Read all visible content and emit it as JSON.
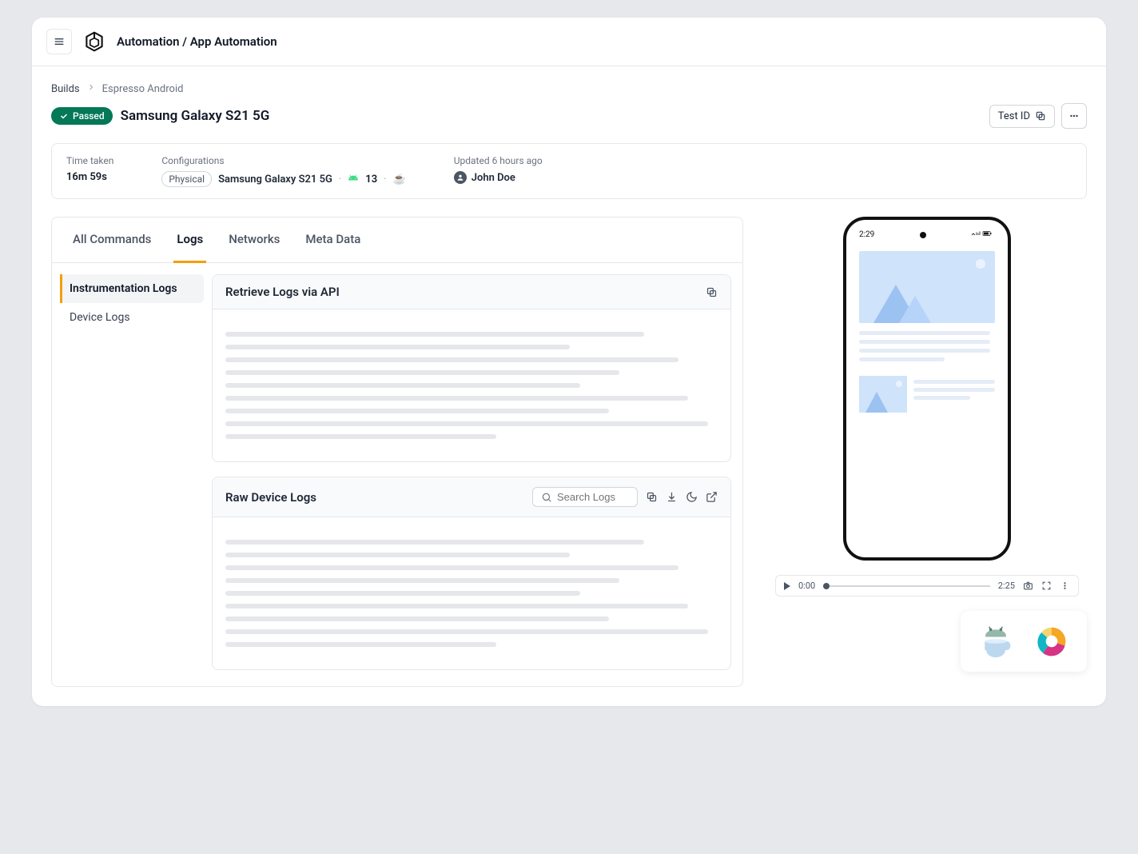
{
  "header": {
    "title": "Automation / App Automation"
  },
  "breadcrumb": {
    "root": "Builds",
    "current": "Espresso Android"
  },
  "status": {
    "label": "Passed"
  },
  "page_title": "Samsung Galaxy S21 5G",
  "actions": {
    "test_id": "Test ID"
  },
  "info": {
    "time_label": "Time taken",
    "time_value": "16m 59s",
    "config_label": "Configurations",
    "config_chip": "Physical",
    "config_device": "Samsung Galaxy S21 5G",
    "config_os_version": "13",
    "updated_label": "Updated 6 hours ago",
    "updated_user": "John Doe"
  },
  "tabs": {
    "items": [
      "All Commands",
      "Logs",
      "Networks",
      "Meta Data"
    ],
    "active": "Logs"
  },
  "side": {
    "items": [
      "Instrumentation Logs",
      "Device Logs"
    ],
    "active": "Instrumentation Logs"
  },
  "panels": {
    "api": {
      "title": "Retrieve Logs via API"
    },
    "raw": {
      "title": "Raw Device Logs",
      "search_placeholder": "Search Logs"
    }
  },
  "phone": {
    "time": "2:29"
  },
  "player": {
    "current": "0:00",
    "total": "2:25"
  }
}
